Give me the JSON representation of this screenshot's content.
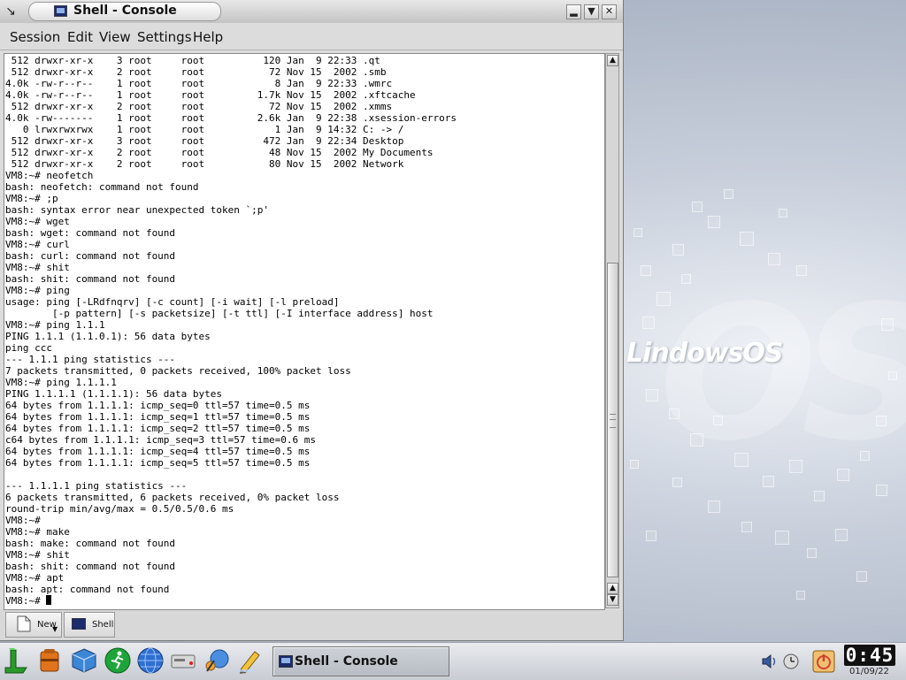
{
  "window": {
    "title": "Shell - Console",
    "buttons": [
      "minimize",
      "maximize",
      "close"
    ]
  },
  "menu": [
    "Session",
    "Edit",
    "View",
    "Settings",
    "Help"
  ],
  "terminal": {
    "lines": [
      " 512 drwxr-xr-x    3 root     root          120 Jan  9 22:33 .qt",
      " 512 drwxr-xr-x    2 root     root           72 Nov 15  2002 .smb",
      "4.0k -rw-r--r--    1 root     root            8 Jan  9 22:33 .wmrc",
      "4.0k -rw-r--r--    1 root     root         1.7k Nov 15  2002 .xftcache",
      " 512 drwxr-xr-x    2 root     root           72 Nov 15  2002 .xmms",
      "4.0k -rw-------    1 root     root         2.6k Jan  9 22:38 .xsession-errors",
      "   0 lrwxrwxrwx    1 root     root            1 Jan  9 14:32 C: -> /",
      " 512 drwxr-xr-x    3 root     root          472 Jan  9 22:34 Desktop",
      " 512 drwxr-xr-x    2 root     root           48 Nov 15  2002 My Documents",
      " 512 drwxr-xr-x    2 root     root           80 Nov 15  2002 Network",
      "VM8:~# neofetch",
      "bash: neofetch: command not found",
      "VM8:~# ;p",
      "bash: syntax error near unexpected token `;p'",
      "VM8:~# wget",
      "bash: wget: command not found",
      "VM8:~# curl",
      "bash: curl: command not found",
      "VM8:~# shit",
      "bash: shit: command not found",
      "VM8:~# ping",
      "usage: ping [-LRdfnqrv] [-c count] [-i wait] [-l preload]",
      "        [-p pattern] [-s packetsize] [-t ttl] [-I interface address] host",
      "VM8:~# ping 1.1.1",
      "PING 1.1.1 (1.1.0.1): 56 data bytes",
      "ping ccc",
      "--- 1.1.1 ping statistics ---",
      "7 packets transmitted, 0 packets received, 100% packet loss",
      "VM8:~# ping 1.1.1.1",
      "PING 1.1.1.1 (1.1.1.1): 56 data bytes",
      "64 bytes from 1.1.1.1: icmp_seq=0 ttl=57 time=0.5 ms",
      "64 bytes from 1.1.1.1: icmp_seq=1 ttl=57 time=0.5 ms",
      "64 bytes from 1.1.1.1: icmp_seq=2 ttl=57 time=0.5 ms",
      "c64 bytes from 1.1.1.1: icmp_seq=3 ttl=57 time=0.6 ms",
      "64 bytes from 1.1.1.1: icmp_seq=4 ttl=57 time=0.5 ms",
      "64 bytes from 1.1.1.1: icmp_seq=5 ttl=57 time=0.5 ms",
      "",
      "--- 1.1.1.1 ping statistics ---",
      "6 packets transmitted, 6 packets received, 0% packet loss",
      "round-trip min/avg/max = 0.5/0.5/0.6 ms",
      "VM8:~#",
      "VM8:~# make",
      "bash: make: command not found",
      "VM8:~# shit",
      "bash: shit: command not found",
      "VM8:~# apt",
      "bash: apt: command not found"
    ],
    "prompt": "VM8:~# "
  },
  "tabs": {
    "new_label": "New",
    "shell_label": "Shell"
  },
  "desktop": {
    "logo_text": "LindowsOS",
    "logo_big": "OS"
  },
  "taskbar": {
    "launchers": [
      "lindows-start-icon",
      "toolbox-icon",
      "cube-icon",
      "runner-icon",
      "globe-icon",
      "drive-icon",
      "network-icon",
      "pencil-icon"
    ],
    "task_label": "Shell - Console",
    "tray": [
      "speaker-icon",
      "clock-app-icon",
      "power-icon"
    ],
    "time": "0:45",
    "date": "01/09/22"
  }
}
